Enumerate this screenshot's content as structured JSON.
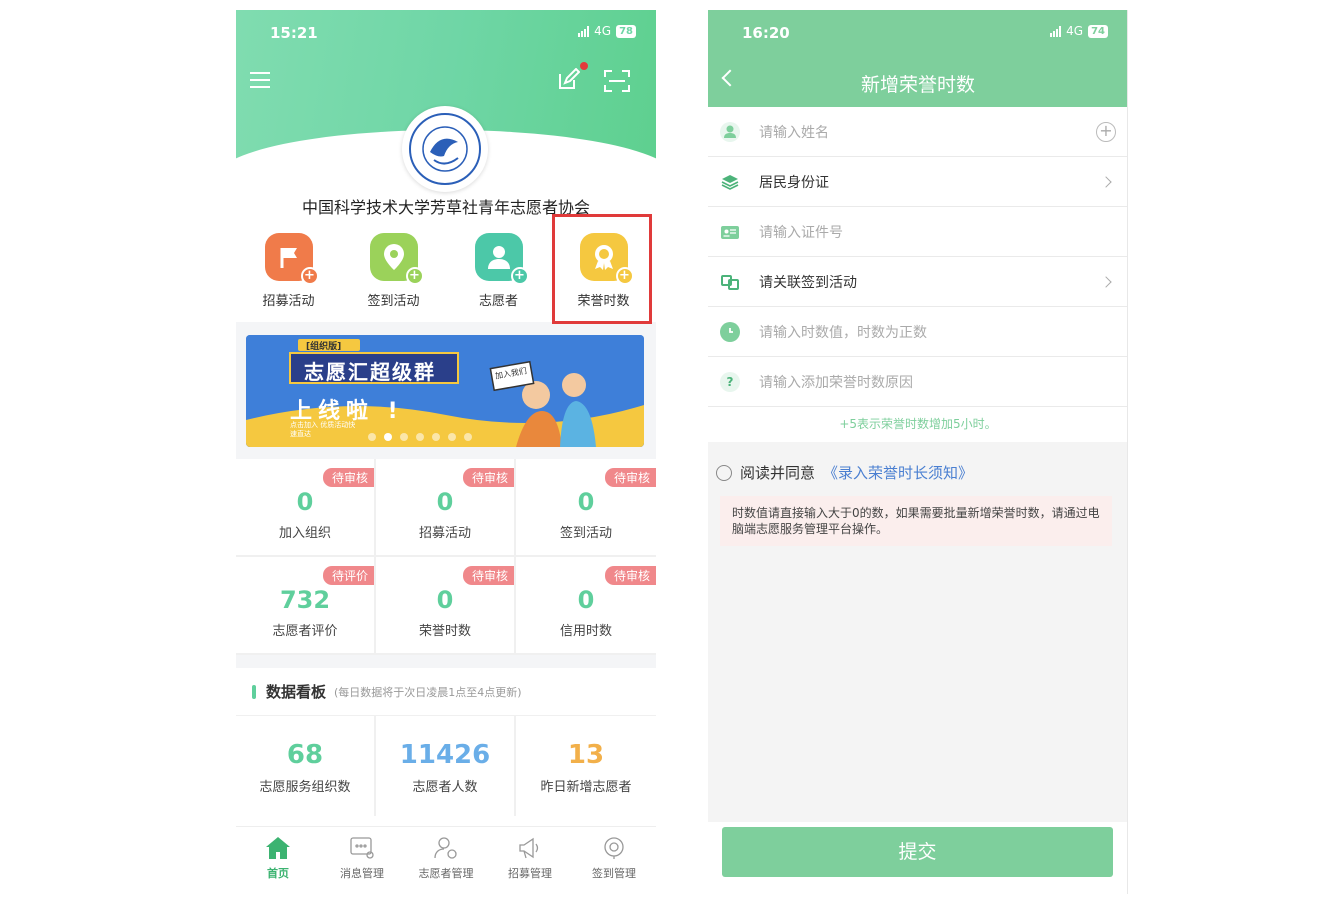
{
  "left": {
    "status": {
      "time": "15:21",
      "network": "4G",
      "battery": "78"
    },
    "org_name": "中国科学技术大学芳草社青年志愿者协会",
    "shortcuts": [
      {
        "label": "招募活动",
        "color": "#f07b4a",
        "icon": "flag-icon"
      },
      {
        "label": "签到活动",
        "color": "#9bd25a",
        "icon": "location-pin-icon"
      },
      {
        "label": "志愿者",
        "color": "#4cc8a8",
        "icon": "person-icon"
      },
      {
        "label": "荣誉时数",
        "color": "#f5c840",
        "icon": "medal-icon"
      }
    ],
    "banner": {
      "tag": "[组织版]",
      "title": "志愿汇超级群",
      "subtitle": "上线啦 !",
      "sign": "加入我们",
      "small": "点击加入 优质活动快速直达"
    },
    "stats": [
      {
        "badge": "待审核",
        "value": "0",
        "label": "加入组织"
      },
      {
        "badge": "待审核",
        "value": "0",
        "label": "招募活动"
      },
      {
        "badge": "待审核",
        "value": "0",
        "label": "签到活动"
      },
      {
        "badge": "待评价",
        "value": "732",
        "label": "志愿者评价"
      },
      {
        "badge": "待审核",
        "value": "0",
        "label": "荣誉时数"
      },
      {
        "badge": "待审核",
        "value": "0",
        "label": "信用时数"
      }
    ],
    "board": {
      "title": "数据看板",
      "note": "(每日数据将于次日凌晨1点至4点更新)",
      "items": [
        {
          "value": "68",
          "label": "志愿服务组织数",
          "color": "#5fcf9c"
        },
        {
          "value": "11426",
          "label": "志愿者人数",
          "color": "#6aaee8"
        },
        {
          "value": "13",
          "label": "昨日新增志愿者",
          "color": "#f2b04a"
        }
      ]
    },
    "tabs": [
      {
        "label": "首页",
        "icon": "home-icon"
      },
      {
        "label": "消息管理",
        "icon": "message-icon"
      },
      {
        "label": "志愿者管理",
        "icon": "volunteer-manage-icon"
      },
      {
        "label": "招募管理",
        "icon": "megaphone-icon"
      },
      {
        "label": "签到管理",
        "icon": "checkin-icon"
      }
    ]
  },
  "right": {
    "status": {
      "time": "16:20",
      "network": "4G",
      "battery": "74"
    },
    "title": "新增荣誉时数",
    "fields": {
      "name_placeholder": "请输入姓名",
      "id_type": "居民身份证",
      "id_placeholder": "请输入证件号",
      "activity": "请关联签到活动",
      "hours_placeholder": "请输入时数值，时数为正数",
      "reason_placeholder": "请输入添加荣誉时数原因"
    },
    "hint": "+5表示荣誉时数增加5小时。",
    "agree_text": "阅读并同意",
    "agree_link": "《录入荣誉时长须知》",
    "notice": "时数值请直接输入大于0的数，如果需要批量新增荣誉时数，请通过电脑端志愿服务管理平台操作。",
    "submit": "提交"
  }
}
